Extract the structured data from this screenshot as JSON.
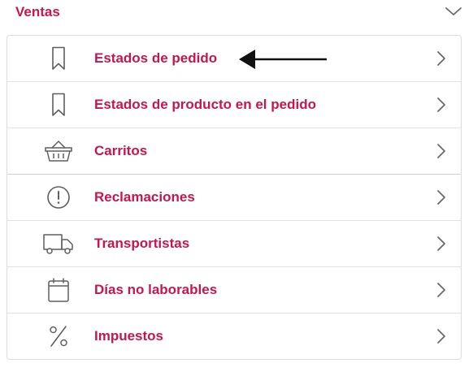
{
  "section": {
    "title": "Ventas",
    "collapse_icon": "chevron-down-icon"
  },
  "menu": {
    "items": [
      {
        "label": "Estados de pedido",
        "icon": "bookmark-icon"
      },
      {
        "label": "Estados de producto en el pedido",
        "icon": "bookmark-icon"
      },
      {
        "label": "Carritos",
        "icon": "basket-icon"
      },
      {
        "label": "Reclamaciones",
        "icon": "alert-circle-icon"
      },
      {
        "label": "Transportistas",
        "icon": "truck-icon"
      },
      {
        "label": "Días no laborables",
        "icon": "calendar-icon"
      },
      {
        "label": "Impuestos",
        "icon": "percent-icon"
      }
    ]
  },
  "colors": {
    "accent": "#c7164f",
    "icon": "#5f5f5f",
    "border": "#dcdcdc"
  }
}
